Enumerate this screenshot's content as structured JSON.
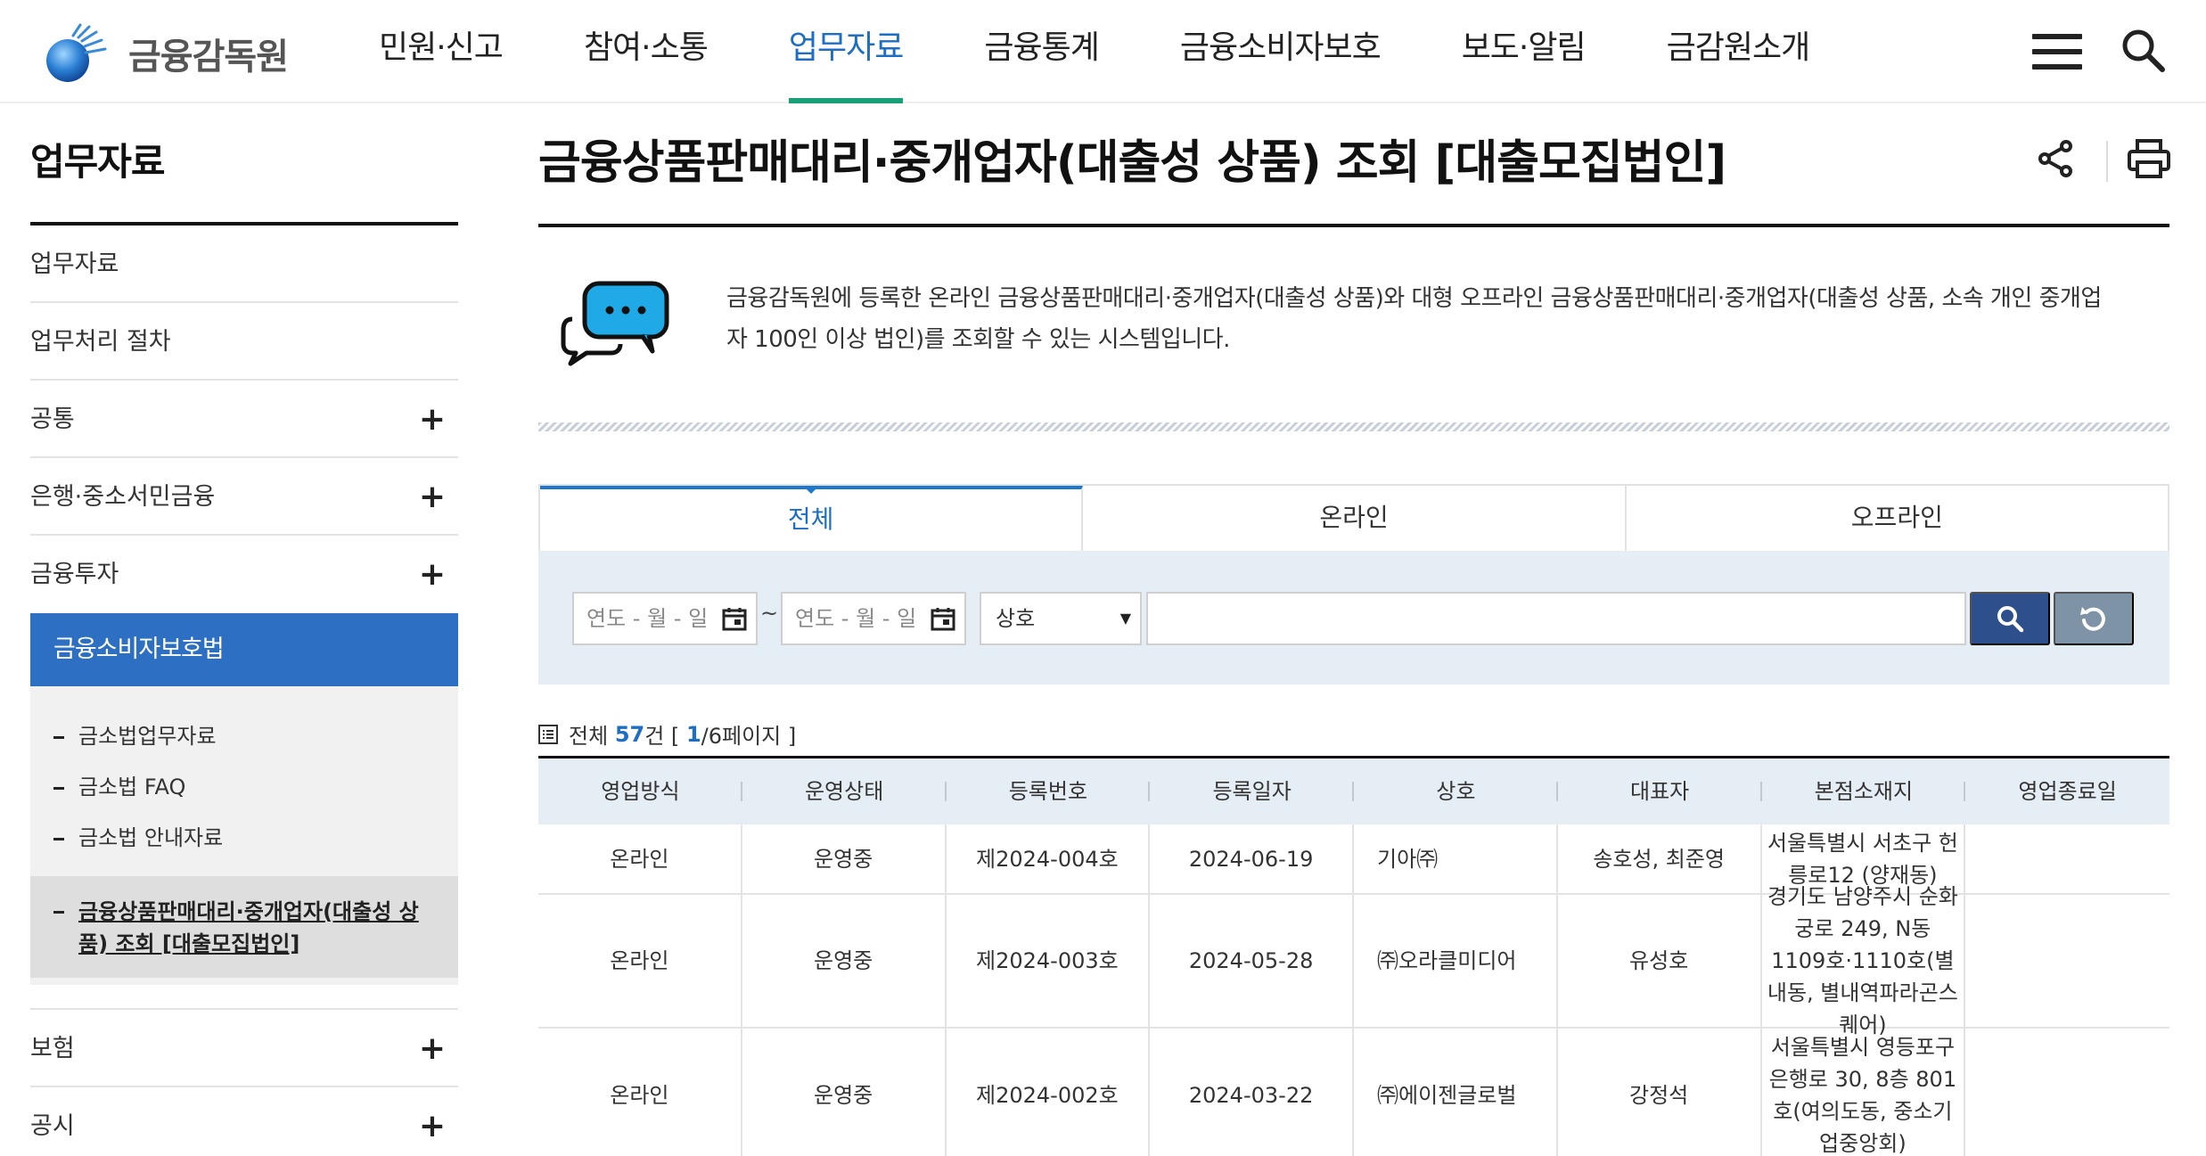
{
  "header": {
    "logo_text": "금융감독원",
    "nav": [
      "민원·신고",
      "참여·소통",
      "업무자료",
      "금융통계",
      "금융소비자보호",
      "보도·알림",
      "금감원소개"
    ],
    "active_nav_index": 2,
    "colors": {
      "brand_blue": "#1e6ec3",
      "nav_underline": "#1aa077"
    }
  },
  "sidebar": {
    "title": "업무자료",
    "items": [
      {
        "label": "업무자료",
        "expandable": false
      },
      {
        "label": "업무처리 절차",
        "expandable": false
      },
      {
        "label": "공통",
        "expandable": true
      },
      {
        "label": "은행·중소서민금융",
        "expandable": true
      },
      {
        "label": "금융투자",
        "expandable": true
      }
    ],
    "active_section": "금융소비자보호법",
    "sub_items": [
      "금소법업무자료",
      "금소법 FAQ",
      "금소법 안내자료"
    ],
    "current_sub": "금융상품판매대리·중개업자(대출성 상품) 조회 [대출모집법인]",
    "items_after": [
      {
        "label": "보험",
        "expandable": true
      },
      {
        "label": "공시",
        "expandable": true
      }
    ],
    "plus_symbol": "+"
  },
  "main": {
    "title": "금융상품판매대리·중개업자(대출성 상품) 조회 [대출모집법인]",
    "intro": "금융감독원에 등록한 온라인 금융상품판매대리·중개업자(대출성 상품)와 대형 오프라인 금융상품판매대리·중개업자(대출성 상품, 소속 개인 중개업자 100인 이상 법인)를 조회할 수 있는 시스템입니다.",
    "tabs": [
      "전체",
      "온라인",
      "오프라인"
    ],
    "active_tab_index": 0,
    "search": {
      "date_from_placeholder": "연도 - 월 - 일",
      "date_to_placeholder": "연도 - 월 - 일",
      "date_separator": "~",
      "field_select": "상호",
      "keyword_value": ""
    },
    "count": {
      "prefix": "전체",
      "total": "57",
      "unit": "건 [",
      "page": "1",
      "page_suffix": "/6페이지 ]"
    },
    "table": {
      "headers": [
        "영업방식",
        "운영상태",
        "등록번호",
        "등록일자",
        "상호",
        "대표자",
        "본점소재지",
        "영업종료일"
      ],
      "rows": [
        [
          "온라인",
          "운영중",
          "제2024-004호",
          "2024-06-19",
          "기아㈜",
          "송호성, 최준영",
          "서울특별시 서초구 헌릉로12 (양재동)",
          ""
        ],
        [
          "온라인",
          "운영중",
          "제2024-003호",
          "2024-05-28",
          "㈜오라클미디어",
          "유성호",
          "경기도 남양주시 순화궁로 249, N동 1109호·1110호(별내동, 별내역파라곤스퀘어)",
          ""
        ],
        [
          "온라인",
          "운영중",
          "제2024-002호",
          "2024-03-22",
          "㈜에이젠글로벌",
          "강정석",
          "서울특별시 영등포구 은행로 30, 8층 801호(여의도동, 중소기업중앙회)",
          ""
        ]
      ]
    }
  },
  "icons": [
    "hamburger-icon",
    "search-icon",
    "share-icon",
    "print-icon",
    "speech-bubble-icon",
    "calendar-icon",
    "refresh-icon",
    "list-icon"
  ]
}
